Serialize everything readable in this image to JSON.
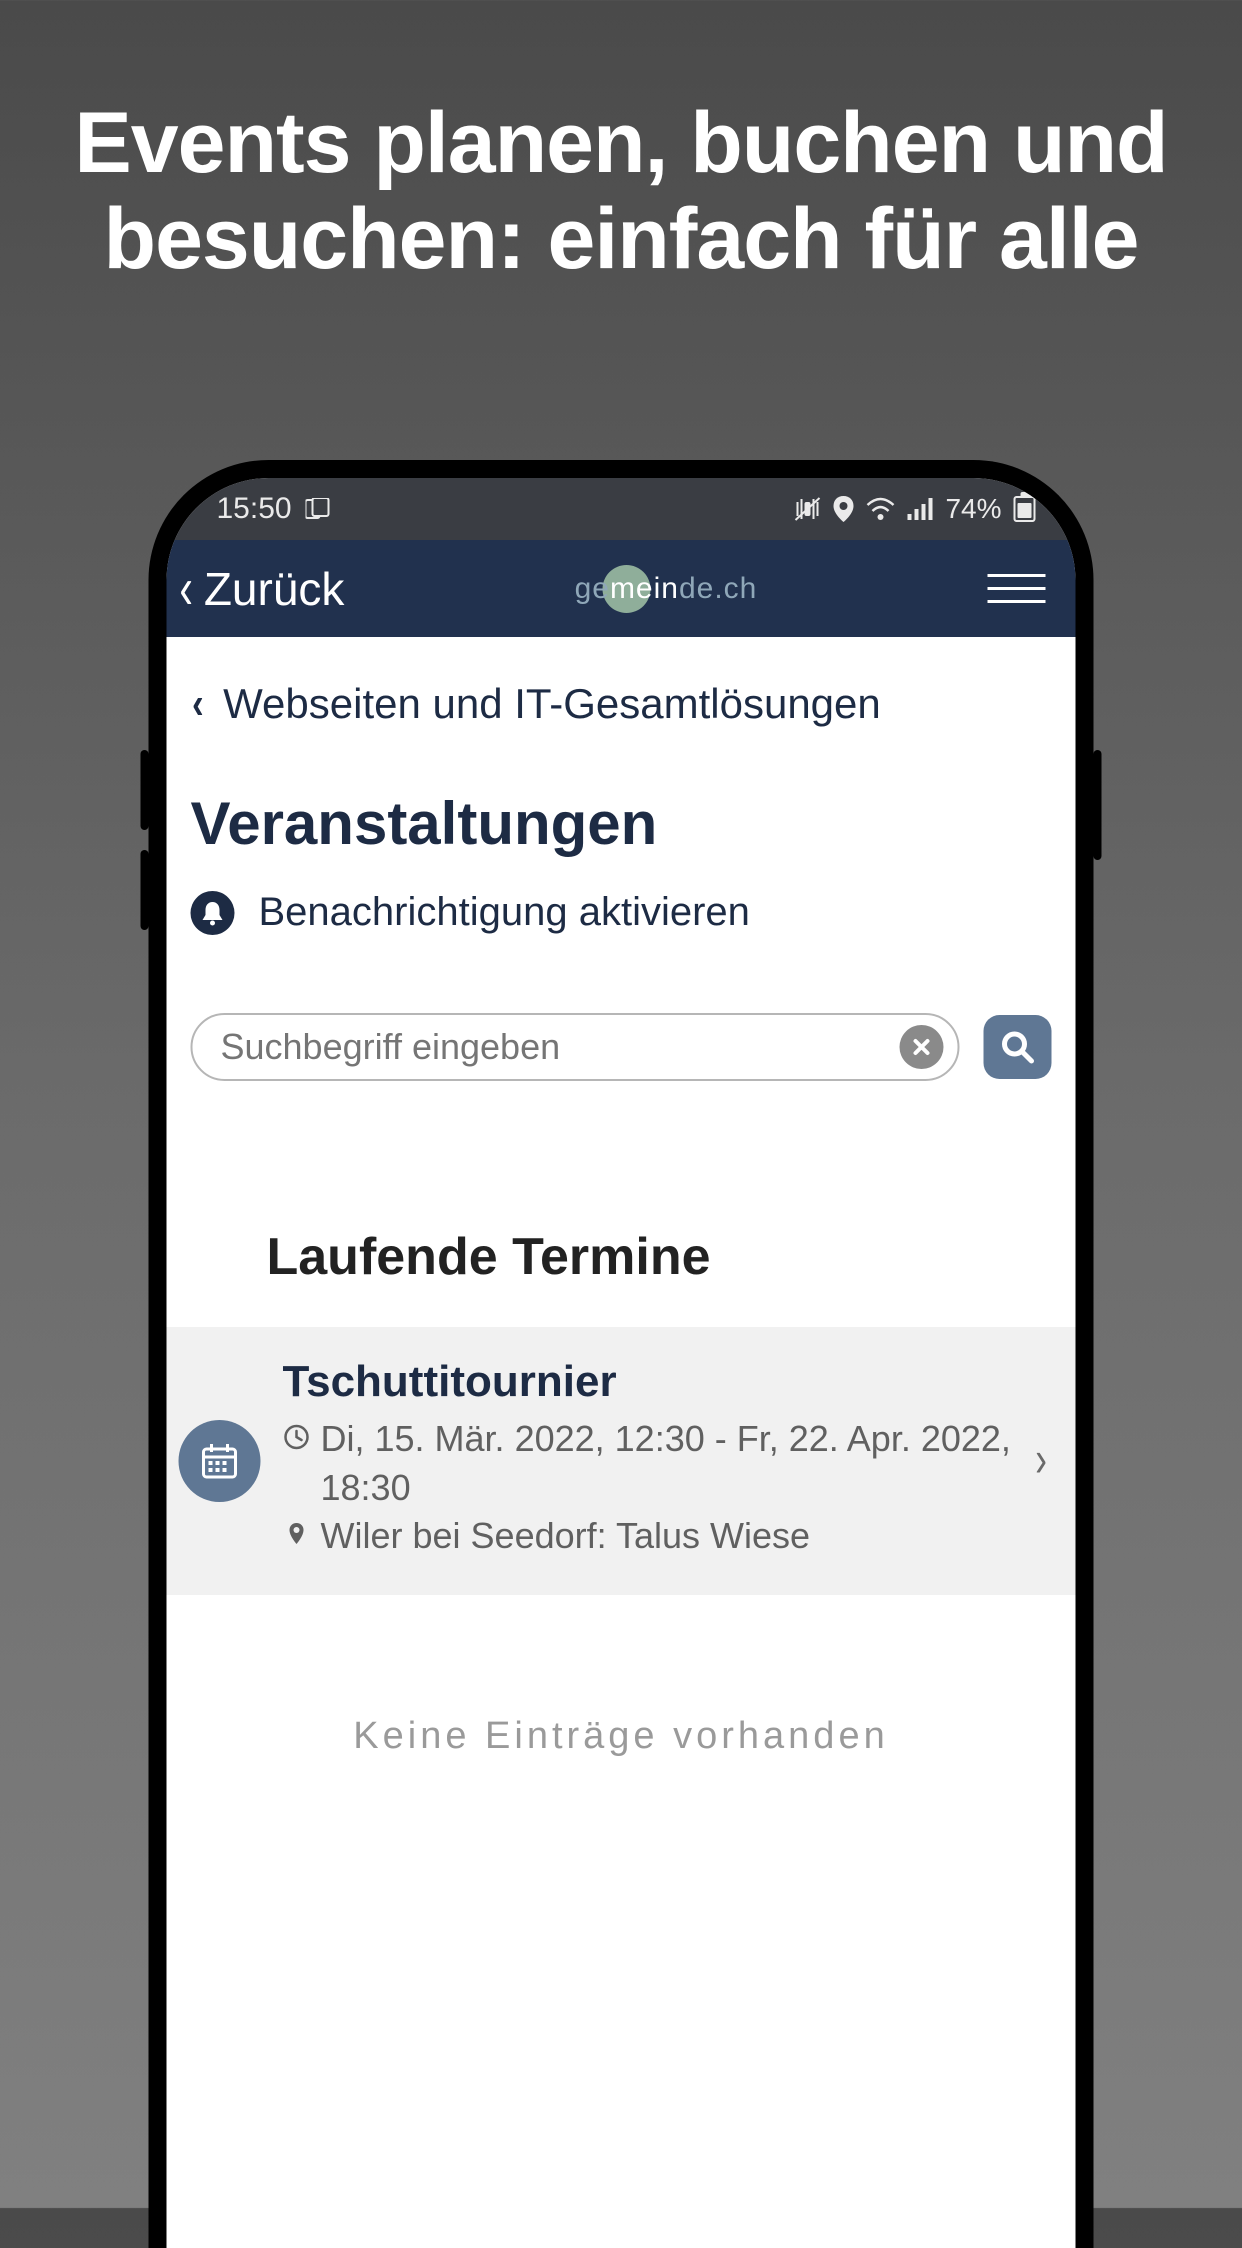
{
  "promo": {
    "headline": "Events planen, buchen und besuchen: einfach für alle"
  },
  "status": {
    "time": "15:50",
    "battery": "74%"
  },
  "header": {
    "back": "Zurück",
    "logo_pre": "ge",
    "logo_mid": "mein",
    "logo_post": "de.ch"
  },
  "breadcrumb": {
    "label": "Webseiten und IT-Gesamtlösungen"
  },
  "page": {
    "title": "Veranstaltungen"
  },
  "notify": {
    "label": "Benachrichtigung aktivieren"
  },
  "search": {
    "placeholder": "Suchbegriff eingeben"
  },
  "section": {
    "title": "Laufende Termine"
  },
  "event": {
    "title": "Tschuttitournier",
    "when": "Di, 15. Mär. 2022, 12:30 - Fr, 22. Apr. 2022, 18:30",
    "where": "Wiler bei Seedorf: Talus Wiese"
  },
  "empty": {
    "message": "Keine Einträge vorhanden"
  }
}
